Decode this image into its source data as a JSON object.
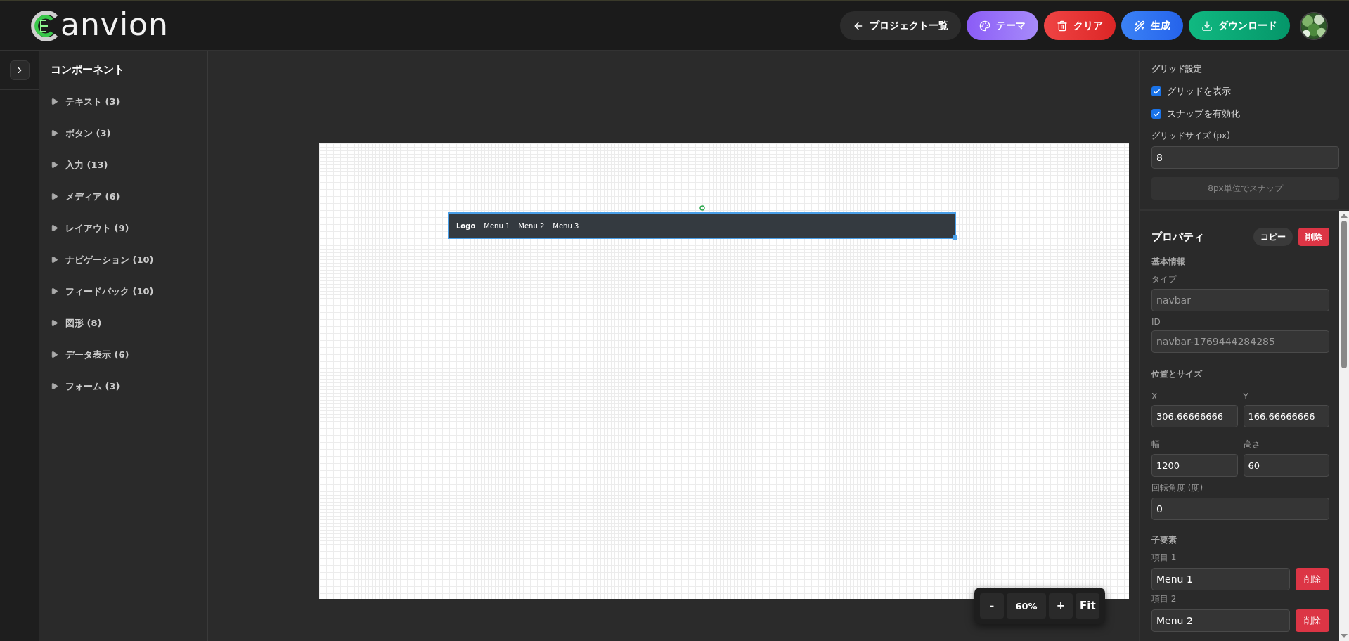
{
  "header": {
    "logo_text": "anvion",
    "buttons": [
      {
        "label": "プロジェクト一覧",
        "kind": "back"
      },
      {
        "label": "テーマ",
        "kind": "theme"
      },
      {
        "label": "クリア",
        "kind": "clear"
      },
      {
        "label": "生成",
        "kind": "generate"
      },
      {
        "label": "ダウンロード",
        "kind": "download"
      }
    ]
  },
  "sidebar": {
    "title": "コンポーネント",
    "expanded": false,
    "items": [
      {
        "label": "テキスト (3)",
        "expanded": false
      },
      {
        "label": "ボタン (3)",
        "expanded": false
      },
      {
        "label": "入力 (13)",
        "expanded": false
      },
      {
        "label": "メディア (6)",
        "expanded": false
      },
      {
        "label": "レイアウト (9)",
        "expanded": false
      },
      {
        "label": "ナビゲーション (10)",
        "expanded": false
      },
      {
        "label": "フィードバック (10)",
        "expanded": false
      },
      {
        "label": "図形 (8)",
        "expanded": false
      },
      {
        "label": "データ表示 (6)",
        "expanded": false
      },
      {
        "label": "フォーム (3)",
        "expanded": false
      }
    ]
  },
  "canvas": {
    "element": {
      "logo": "Logo",
      "links": [
        "Menu 1",
        "Menu 2",
        "Menu 3"
      ],
      "selected": true
    },
    "zoom": {
      "minus": "-",
      "value": "60%",
      "plus": "+",
      "fit": "Fit"
    }
  },
  "grid_settings": {
    "title": "グリッド設定",
    "options": [
      {
        "label": "グリッドを表示",
        "checked": true
      },
      {
        "label": "スナップを有効化",
        "checked": true
      }
    ],
    "size_label": "グリッドサイズ (px)",
    "size_value": "8",
    "snap_button": "8px単位でスナップ"
  },
  "properties": {
    "title": "プロパティ",
    "copy": "コピー",
    "delete": "削除",
    "basic_title": "基本情報",
    "type_label": "タイプ",
    "type_value": "navbar",
    "id_label": "ID",
    "id_value": "navbar-1769444284285",
    "position_title": "位置とサイズ",
    "fields": [
      {
        "label": "X",
        "value": "306.66666666"
      },
      {
        "label": "Y",
        "value": "166.66666666"
      },
      {
        "label": "幅",
        "value": "1200"
      },
      {
        "label": "高さ",
        "value": "60"
      }
    ],
    "rotation_label": "回転角度 (度)",
    "rotation_value": "0",
    "children_title": "子要素",
    "children": [
      {
        "label": "項目 1",
        "value": "Menu 1",
        "delete": "削除"
      },
      {
        "label": "項目 2",
        "value": "Menu 2",
        "delete": "削除"
      }
    ]
  }
}
